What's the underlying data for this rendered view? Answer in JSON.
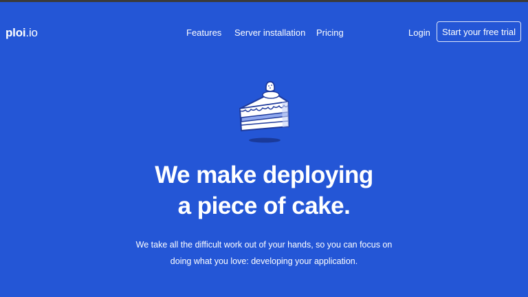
{
  "brand": {
    "name_bold": "ploi",
    "name_light": ".io"
  },
  "nav": {
    "items": [
      {
        "label": "Features"
      },
      {
        "label": "Server installation"
      },
      {
        "label": "Pricing"
      }
    ],
    "login_label": "Login",
    "cta_label": "Start your free trial"
  },
  "hero": {
    "illustration_icon": "cake-slice-icon",
    "headline_line1": "We make deploying",
    "headline_line2": "a piece of cake.",
    "subtext_line1": "We take all the difficult work out of your hands, so you can focus on",
    "subtext_line2": "doing what you love: developing your application."
  },
  "colors": {
    "background": "#2456d6",
    "text": "#ffffff",
    "cake_outline": "#1e3a9c",
    "cake_cream": "#ffffff",
    "cake_filling": "#8fa8ee"
  }
}
